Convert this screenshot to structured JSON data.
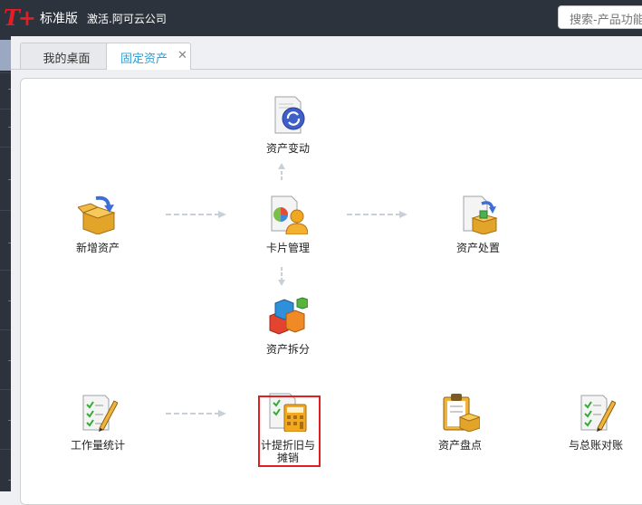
{
  "topbar": {
    "logo": "T+",
    "edition": "标准版",
    "company": "激活.阿可云公司",
    "search_placeholder": "搜索-产品功能"
  },
  "tabs": [
    {
      "label": "我的桌面",
      "active": false
    },
    {
      "label": "固定资产",
      "active": true
    }
  ],
  "flow": {
    "asset_change": "资产变动",
    "add_asset": "新增资产",
    "card_management": "卡片管理",
    "asset_disposal": "资产处置",
    "asset_split": "资产拆分",
    "workload_stats": "工作量统计",
    "depreciation_line1": "计提折旧与",
    "depreciation_line2": "摊销",
    "asset_inventory": "资产盘点",
    "reconcile_ledger": "与总账对账"
  },
  "colors": {
    "topbar": "#2d333c",
    "brand_red": "#e41e26",
    "tab_active_text": "#2aa0d8",
    "highlight_border": "#e02020"
  }
}
